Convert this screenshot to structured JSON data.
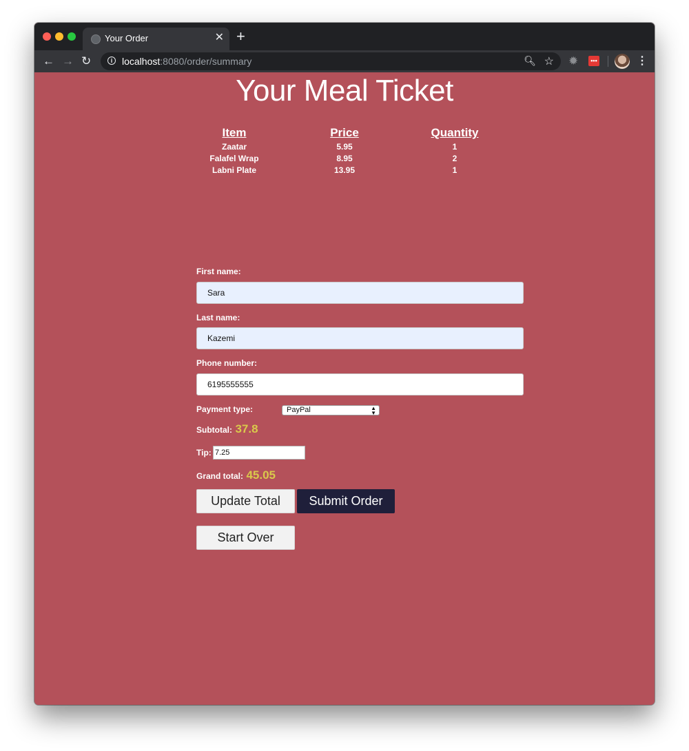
{
  "browser": {
    "tab_title": "Your Order",
    "url_host": "localhost",
    "url_rest": ":8080/order/summary"
  },
  "page": {
    "heading": "Your Meal Ticket",
    "table": {
      "headers": [
        "Item",
        "Price",
        "Quantity"
      ],
      "rows": [
        [
          "Zaatar",
          "5.95",
          "1"
        ],
        [
          "Falafel Wrap",
          "8.95",
          "2"
        ],
        [
          "Labni Plate",
          "13.95",
          "1"
        ]
      ]
    },
    "form": {
      "first_name_label": "First name:",
      "first_name_value": "Sara",
      "last_name_label": "Last name:",
      "last_name_value": "Kazemi",
      "phone_label": "Phone number:",
      "phone_value": "6195555555",
      "payment_label": "Payment type:",
      "payment_selected": "PayPal",
      "subtotal_label": "Subtotal:",
      "subtotal_value": "37.8",
      "tip_label": "Tip:",
      "tip_value": "7.25",
      "grand_total_label": "Grand total:",
      "grand_total_value": "45.05"
    },
    "buttons": {
      "update_total": "Update Total",
      "submit_order": "Submit Order",
      "start_over": "Start Over"
    }
  },
  "colors": {
    "page_background": "#b4515a",
    "money_accent": "#d9c94b",
    "submit_button": "#1f1f3a"
  }
}
